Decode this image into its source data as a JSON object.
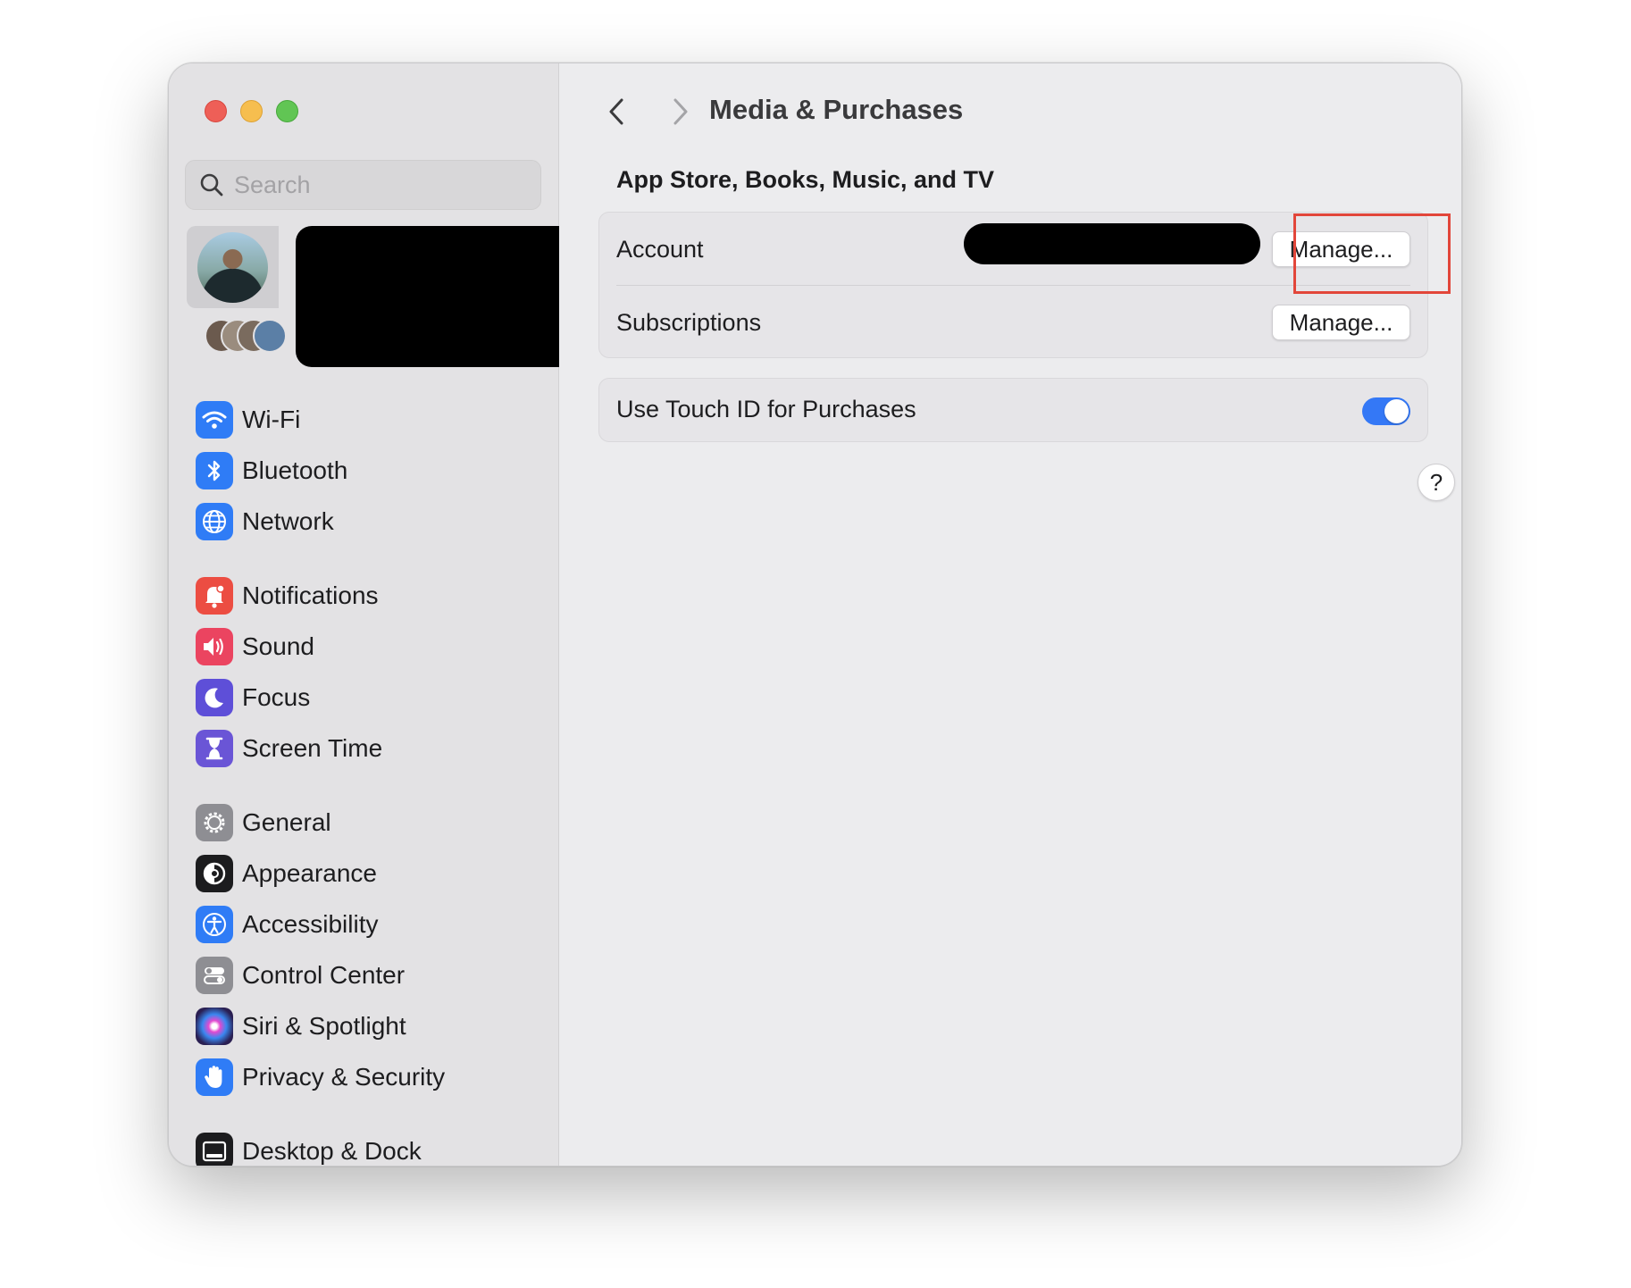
{
  "window": {
    "traffic_lights": [
      "close",
      "minimize",
      "zoom"
    ]
  },
  "sidebar": {
    "search": {
      "placeholder": "Search",
      "value": ""
    },
    "groups": [
      [
        {
          "label": "Wi-Fi",
          "icon": "wifi-icon",
          "color": "#2f7cf6"
        },
        {
          "label": "Bluetooth",
          "icon": "bluetooth-icon",
          "color": "#2f7cf6"
        },
        {
          "label": "Network",
          "icon": "globe-icon",
          "color": "#2f7cf6"
        }
      ],
      [
        {
          "label": "Notifications",
          "icon": "bell-icon",
          "color": "#ec4d42"
        },
        {
          "label": "Sound",
          "icon": "speaker-icon",
          "color": "#eb4460"
        },
        {
          "label": "Focus",
          "icon": "moon-icon",
          "color": "#5e4fd8"
        },
        {
          "label": "Screen Time",
          "icon": "hourglass-icon",
          "color": "#6a55d6"
        }
      ],
      [
        {
          "label": "General",
          "icon": "gear-icon",
          "color": "#8e8e93"
        },
        {
          "label": "Appearance",
          "icon": "appearance-icon",
          "color": "#1c1c1e"
        },
        {
          "label": "Accessibility",
          "icon": "accessibility-icon",
          "color": "#2f7cf6"
        },
        {
          "label": "Control Center",
          "icon": "toggles-icon",
          "color": "#8e8e93"
        },
        {
          "label": "Siri & Spotlight",
          "icon": "siri-icon",
          "color": "#3a2b6b"
        },
        {
          "label": "Privacy & Security",
          "icon": "hand-icon",
          "color": "#2f7cf6"
        }
      ],
      [
        {
          "label": "Desktop & Dock",
          "icon": "dock-icon",
          "color": "#1c1c1e"
        }
      ]
    ]
  },
  "content": {
    "title": "Media & Purchases",
    "section_title": "App Store, Books, Music, and TV",
    "account": {
      "label": "Account",
      "button": "Manage..."
    },
    "subscriptions": {
      "label": "Subscriptions",
      "button": "Manage..."
    },
    "touch_id": {
      "label": "Use Touch ID for Purchases",
      "enabled": true
    },
    "help": "?",
    "highlight_color": "#e2463a",
    "accent_color": "#3478f6"
  }
}
